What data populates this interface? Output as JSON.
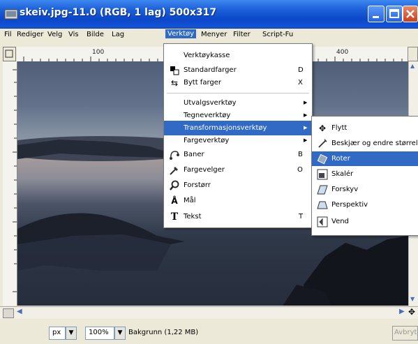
{
  "window": {
    "title": "skeiv.jpg-11.0 (RGB, 1 lag) 500x317"
  },
  "menubar": {
    "items": [
      "Fil",
      "Rediger",
      "Velg",
      "Vis",
      "Bilde",
      "Lag",
      "Verktøy",
      "Menyer",
      "Filter",
      "Script-Fu"
    ]
  },
  "ruler": {
    "top_labels": [
      "100",
      "400"
    ]
  },
  "tools_menu": {
    "items": [
      {
        "label": "Verktøykasse",
        "key": ""
      },
      {
        "label": "Standardfarger",
        "key": "D"
      },
      {
        "label": "Bytt farger",
        "key": "X"
      },
      {
        "label": "Utvalgsverktøy",
        "key": ""
      },
      {
        "label": "Tegneverktøy",
        "key": ""
      },
      {
        "label": "Transformasjonsverktøy",
        "key": ""
      },
      {
        "label": "Fargeverktøy",
        "key": ""
      },
      {
        "label": "Baner",
        "key": "B"
      },
      {
        "label": "Fargevelger",
        "key": "O"
      },
      {
        "label": "Forstørr",
        "key": ""
      },
      {
        "label": "Mål",
        "key": ""
      },
      {
        "label": "Tekst",
        "key": "T"
      }
    ]
  },
  "transform_menu": {
    "items": [
      {
        "label": "Flytt"
      },
      {
        "label": "Beskjær og endre størrelse"
      },
      {
        "label": "Roter"
      },
      {
        "label": "Skalér"
      },
      {
        "label": "Forskyv"
      },
      {
        "label": "Perspektiv"
      },
      {
        "label": "Vend"
      }
    ]
  },
  "statusbar": {
    "unit": "px",
    "zoom": "100%",
    "layer_info": "Bakgrunn (1,22 MB)",
    "cancel": "Avbryt"
  },
  "colors": {
    "highlight": "#316ac5",
    "titlebar": "#0b47c9"
  }
}
